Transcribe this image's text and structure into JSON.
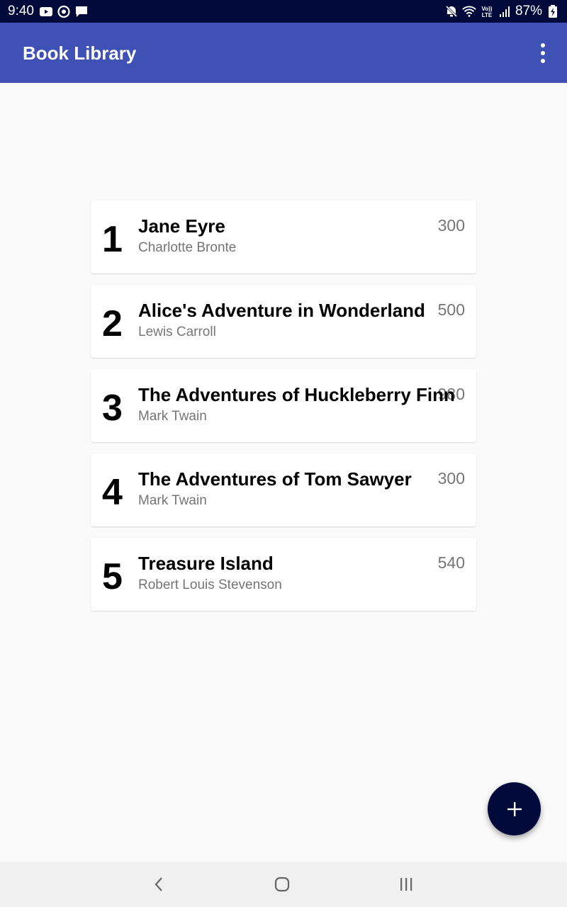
{
  "status_bar": {
    "time": "9:40",
    "battery": "87%",
    "icons_left": [
      "youtube-icon",
      "sync-icon",
      "message-icon"
    ],
    "icons_right": [
      "mute-icon",
      "wifi-icon",
      "volte-icon",
      "signal-icon",
      "battery-icon"
    ]
  },
  "app_bar": {
    "title": "Book Library",
    "menu_icon": "more-vert-icon"
  },
  "books": [
    {
      "id": "1",
      "title": "Jane Eyre",
      "author": "Charlotte Bronte",
      "pages": "300"
    },
    {
      "id": "2",
      "title": "Alice's Adventure in Wonderland",
      "author": "Lewis Carroll",
      "pages": "500"
    },
    {
      "id": "3",
      "title": "The Adventures of Huckleberry Finn",
      "author": "Mark Twain",
      "pages": "980"
    },
    {
      "id": "4",
      "title": "The Adventures of Tom Sawyer",
      "author": "Mark Twain",
      "pages": "300"
    },
    {
      "id": "5",
      "title": "Treasure Island",
      "author": "Robert Louis Stevenson",
      "pages": "540"
    }
  ],
  "fab": {
    "icon": "add-icon"
  },
  "nav_bar": {
    "icons": [
      "back-icon",
      "home-icon",
      "recents-icon"
    ]
  }
}
